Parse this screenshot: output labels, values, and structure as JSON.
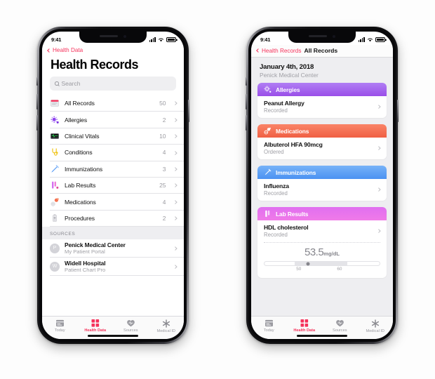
{
  "status_bar": {
    "time": "9:41",
    "signal_icon": "cellular-bars-icon",
    "wifi_icon": "wifi-icon",
    "battery_icon": "battery-icon"
  },
  "colors": {
    "accent_pink": "#f5325b",
    "allergies": "#a25ded",
    "medications": "#f4714f",
    "immunizations": "#5a9df5",
    "lab_results": "#e55fe0",
    "separator": "#e2e2e6",
    "muted_text": "#9a9aa0",
    "group_bg": "#eeeef1"
  },
  "left_phone": {
    "nav": {
      "back_label": "Health Data",
      "back_icon": "chevron-left-icon"
    },
    "page_title": "Health Records",
    "search": {
      "placeholder": "Search",
      "value": "",
      "icon": "search-icon"
    },
    "records": [
      {
        "label": "All Records",
        "count": "50",
        "icon": "all-records-icon"
      },
      {
        "label": "Allergies",
        "count": "2",
        "icon": "allergies-icon"
      },
      {
        "label": "Clinical Vitals",
        "count": "10",
        "icon": "clinical-vitals-icon"
      },
      {
        "label": "Conditions",
        "count": "4",
        "icon": "conditions-icon"
      },
      {
        "label": "Immunizations",
        "count": "3",
        "icon": "immunizations-icon"
      },
      {
        "label": "Lab Results",
        "count": "25",
        "icon": "lab-results-icon"
      },
      {
        "label": "Medications",
        "count": "4",
        "icon": "medications-icon"
      },
      {
        "label": "Procedures",
        "count": "2",
        "icon": "procedures-icon"
      }
    ],
    "sources_header": "SOURCES",
    "sources": [
      {
        "initial": "P",
        "name": "Penick Medical Center",
        "subtitle": "My Patient Portal"
      },
      {
        "initial": "W",
        "name": "Widell Hospital",
        "subtitle": "Patient Chart Pro"
      }
    ]
  },
  "right_phone": {
    "nav": {
      "back_label": "Health Records",
      "title": "All Records",
      "back_icon": "chevron-left-icon"
    },
    "date": "January 4th, 2018",
    "provider": "Penick Medical Center",
    "cards": [
      {
        "title": "Allergies",
        "icon": "allergen-burst-icon",
        "item": "Peanut Allergy",
        "status": "Recorded"
      },
      {
        "title": "Medications",
        "icon": "pills-icon",
        "item": "Albuterol HFA 90mcg",
        "status": "Ordered"
      },
      {
        "title": "Immunizations",
        "icon": "syringe-icon",
        "item": "Influenza",
        "status": "Recorded"
      },
      {
        "title": "Lab Results",
        "icon": "test-tubes-icon",
        "item": "HDL cholesterol",
        "status": "Recorded",
        "measurement": {
          "value": "53.5",
          "unit": "mg/dL",
          "scale_low": "50",
          "scale_high": "60"
        }
      }
    ]
  },
  "tabs": [
    {
      "label": "Today",
      "icon": "today-card-icon",
      "active": false
    },
    {
      "label": "Health Data",
      "icon": "health-data-icon",
      "active": true
    },
    {
      "label": "Sources",
      "icon": "sources-heart-icon",
      "active": false
    },
    {
      "label": "Medical ID",
      "icon": "medical-id-icon",
      "active": false
    }
  ]
}
